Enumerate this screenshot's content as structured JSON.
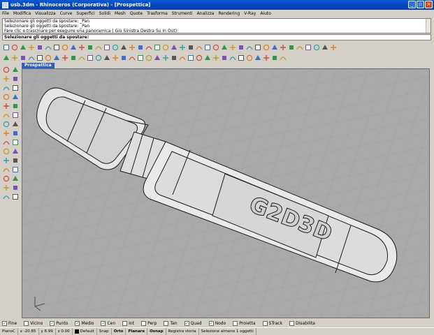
{
  "window": {
    "title": "usb.3dm - Rhinoceros (Corporativa) - [Prospettica]",
    "buttons": [
      "_",
      "▫",
      "×"
    ]
  },
  "menu": [
    "File",
    "Modifica",
    "Visualizza",
    "Curve",
    "Superfici",
    "Solidi",
    "Mesh",
    "Quote",
    "Trasforma",
    "Strumenti",
    "Analizza",
    "Rendering",
    "V-Ray",
    "Aiuto"
  ],
  "command": {
    "history": [
      "Selezionare gli oggetti da spostare: _Pan",
      "Selezionare gli oggetti da spostare: _Pan",
      "Fare clic e trascinare per eseguire una panoramica ( Giù  Sinistra  Destra  Su  In  Out):"
    ],
    "prompt": "Selezionare gli oggetti da spostare:"
  },
  "viewport": {
    "label": "Prospettica",
    "model_text": "G2D3D"
  },
  "toolbar1_icons": [
    "new-icon",
    "open-icon",
    "save-icon",
    "print-icon",
    "import-icon",
    "cut-icon",
    "copy-icon",
    "paste-icon",
    "undo-icon",
    "redo-icon",
    "pan-icon",
    "rotate-view-icon",
    "zoom-icon",
    "zoom-window-icon",
    "zoom-extents-icon",
    "zoom-selected-icon",
    "four-views-icon",
    "grid-icon",
    "cplane-icon",
    "ortho-icon",
    "snap-icon",
    "select-all-icon",
    "layer-icon",
    "light-icon",
    "properties-icon",
    "render-icon",
    "material-icon",
    "wireframe-icon",
    "shaded-icon",
    "rendered-icon",
    "ghosted-icon",
    "xray-icon",
    "help-icon",
    "vray-render-icon",
    "vray-options-icon",
    "vray-material-icon",
    "vray-frame-icon",
    "vray-light-icon",
    "vray-sun-icon",
    "vray-camera-icon"
  ],
  "toolbar2_icons": [
    "point-icon",
    "line-icon",
    "polyline-icon",
    "curve-icon",
    "circle-icon",
    "arc-icon",
    "ellipse-icon",
    "rectangle-icon",
    "polygon-icon",
    "surface-icon",
    "extrude-icon",
    "loft-icon",
    "revolve-icon",
    "sweep-icon",
    "box-icon",
    "sphere-icon",
    "cylinder-icon",
    "boolean-union-icon",
    "boolean-diff-icon",
    "fillet-icon",
    "chamfer-icon",
    "offset-icon",
    "trim-icon",
    "split-icon",
    "join-icon",
    "explode-icon",
    "move-icon",
    "copy-obj-icon",
    "rotate-icon",
    "scale-icon",
    "mirror-icon",
    "array-icon",
    "align-icon",
    "group-icon"
  ],
  "left_icons": [
    "select-icon",
    "point-tool-icon",
    "polyline-tool-icon",
    "rectangle-tool-icon",
    "circle-tool-icon",
    "ellipse-tool-icon",
    "arc-tool-icon",
    "curve-tool-icon",
    "fillet-curve-icon",
    "polygon-tool-icon",
    "surface-corner-icon",
    "extrude-tool-icon",
    "box-tool-icon",
    "sphere-tool-icon",
    "boolean-tool-icon",
    "fillet-edge-icon",
    "move-tool-icon",
    "copy-tool-icon",
    "rotate-tool-icon",
    "scale-tool-icon",
    "mirror-tool-icon",
    "trim-tool-icon",
    "split-tool-icon",
    "join-tool-icon",
    "explode-tool-icon",
    "group-tool-icon",
    "dimension-tool-icon",
    "text-tool-icon",
    "render-tool-icon",
    "analyze-tool-icon"
  ],
  "osnap": [
    {
      "label": "Fine",
      "checked": true
    },
    {
      "label": "Vicino",
      "checked": false
    },
    {
      "label": "Punto",
      "checked": true
    },
    {
      "label": "Medio",
      "checked": true
    },
    {
      "label": "Cen",
      "checked": true
    },
    {
      "label": "Int",
      "checked": false
    },
    {
      "label": "Perp",
      "checked": false
    },
    {
      "label": "Tan",
      "checked": false
    },
    {
      "label": "Quad",
      "checked": true
    },
    {
      "label": "Nodo",
      "checked": true
    },
    {
      "label": "Proietta",
      "checked": false
    },
    {
      "label": "STrack",
      "checked": false
    },
    {
      "label": "Disabilita",
      "checked": false
    }
  ],
  "status": {
    "cplane": "PianoC",
    "x": "x -20.85",
    "y": "y 8.99",
    "z": "z 0.00",
    "layer": "Default",
    "snap": "Snap",
    "orto": "Orto",
    "planare": "Planare",
    "osnap": "Osnap",
    "history": "Registra storia",
    "message": "Selezione almeno 1 oggetti"
  },
  "colors": {
    "titlebar": "#0a5ad8",
    "viewport_bg": "#a9a9a9",
    "tab": "#2c5fc8"
  }
}
